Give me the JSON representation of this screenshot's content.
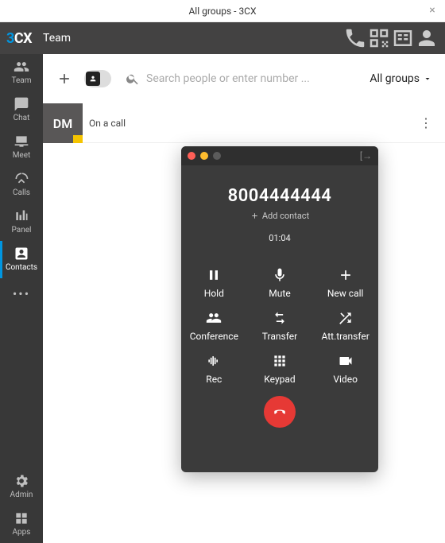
{
  "window": {
    "title": "All groups - 3CX"
  },
  "brand": {
    "three": "3",
    "cx": "CX"
  },
  "topbar": {
    "team": "Team"
  },
  "nav": {
    "team": "Team",
    "chat": "Chat",
    "meet": "Meet",
    "calls": "Calls",
    "panel": "Panel",
    "contacts": "Contacts",
    "admin": "Admin",
    "apps": "Apps"
  },
  "toolbar": {
    "search_placeholder": "Search people or enter number ...",
    "group_select": "All groups"
  },
  "contacts": [
    {
      "initials": "DM",
      "status_text": "On a call",
      "status": "busy"
    }
  ],
  "call": {
    "number": "8004444444",
    "add_contact": "Add contact",
    "duration": "01:04",
    "actions": {
      "hold": "Hold",
      "mute": "Mute",
      "new_call": "New call",
      "conference": "Conference",
      "transfer": "Transfer",
      "att_transfer": "Att.transfer",
      "rec": "Rec",
      "keypad": "Keypad",
      "video": "Video"
    }
  }
}
